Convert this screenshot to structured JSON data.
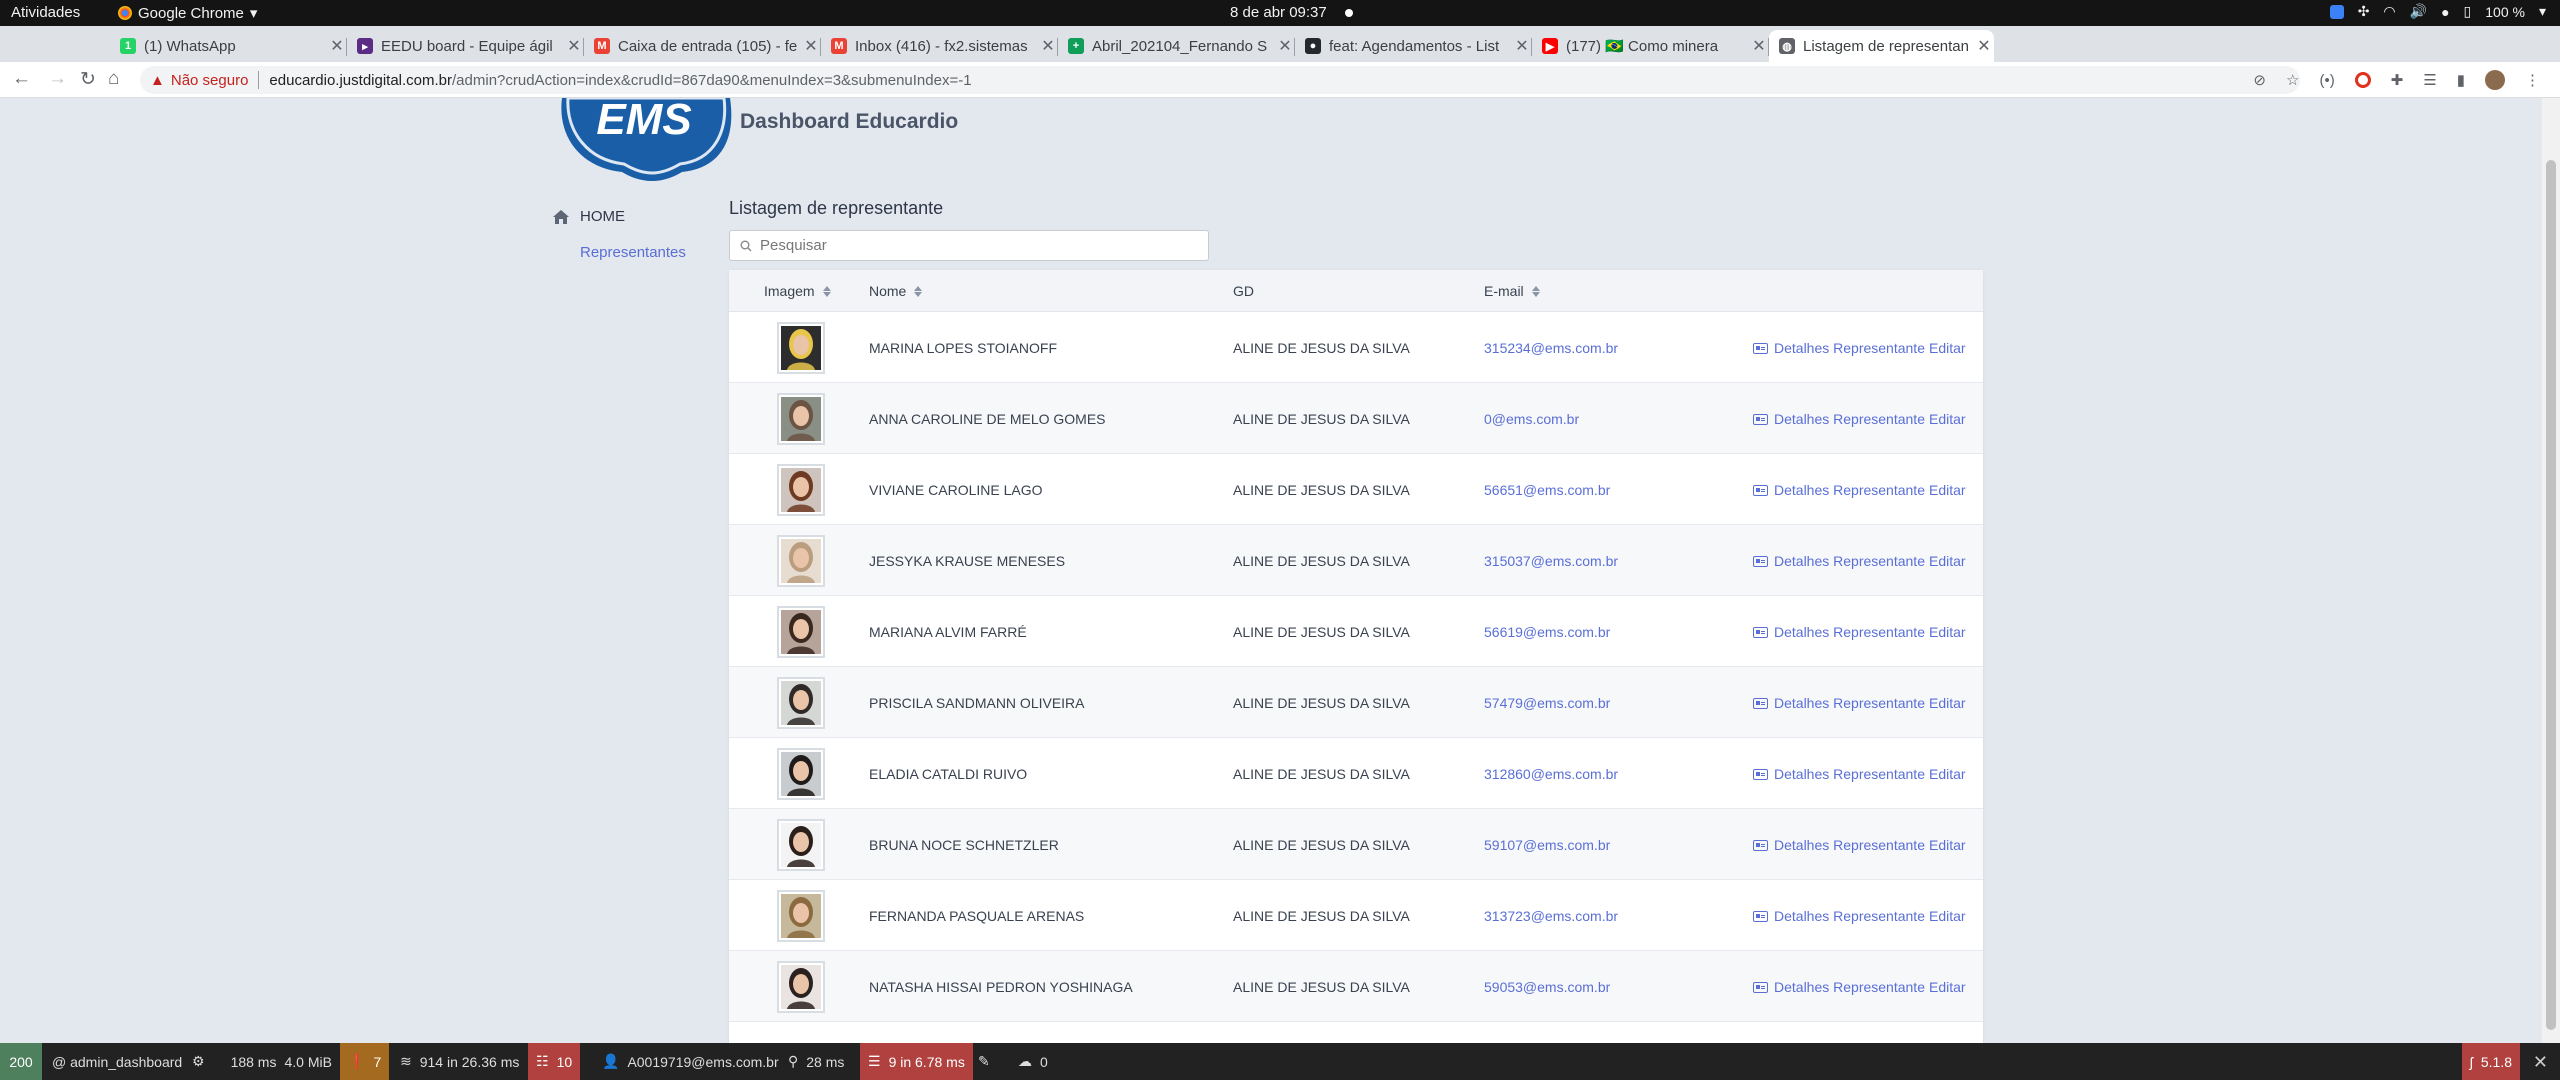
{
  "topbar": {
    "activities": "Atividades",
    "app_name": "Google Chrome",
    "clock": "8 de abr  09:37",
    "battery": "100 %"
  },
  "browser": {
    "tabs": [
      {
        "title": "(1) WhatsApp",
        "fav_color": "#25d366",
        "fav_glyph": "1"
      },
      {
        "title": "EEDU board - Equipe ágil",
        "fav_color": "#5b2c83",
        "fav_glyph": "▸"
      },
      {
        "title": "Caixa de entrada (105) - fe",
        "fav_color": "#ea4335",
        "fav_glyph": "M"
      },
      {
        "title": "Inbox (416) - fx2.sistemas",
        "fav_color": "#ea4335",
        "fav_glyph": "M"
      },
      {
        "title": "Abril_202104_Fernando S",
        "fav_color": "#0f9d58",
        "fav_glyph": "+"
      },
      {
        "title": "feat: Agendamentos - List",
        "fav_color": "#24292e",
        "fav_glyph": "●"
      },
      {
        "title": "(177) 🇧🇷 Como minera",
        "fav_color": "#ff0000",
        "fav_glyph": "▶"
      },
      {
        "title": "Listagem de representan",
        "fav_color": "#5f6368",
        "fav_glyph": "◍"
      }
    ],
    "url_insecure": "Não seguro",
    "url_host": "educardio.justdigital.com.br",
    "url_path": "/admin?crudAction=index&crudId=867da90&menuIndex=3&submenuIndex=-1"
  },
  "brand": {
    "logo_text": "EMS",
    "dashboard_title": "Dashboard Educardio"
  },
  "sidebar": {
    "home_label": "HOME",
    "items": [
      {
        "label": "Representantes"
      }
    ]
  },
  "main": {
    "title": "Listagem de representante",
    "search_placeholder": "Pesquisar",
    "columns": {
      "image": "Imagem",
      "name": "Nome",
      "gd": "GD",
      "email": "E-mail"
    },
    "action_details": "Detalhes Representante",
    "action_edit": "Editar",
    "rows": [
      {
        "name": "MARINA LOPES STOIANOFF",
        "gd": "ALINE DE JESUS DA SILVA",
        "email": "315234@ems.com.br",
        "hair": "#e8c64a",
        "bg": "#2d2d2d"
      },
      {
        "name": "ANNA CAROLINE DE MELO GOMES",
        "gd": "ALINE DE JESUS DA SILVA",
        "email": "0@ems.com.br",
        "hair": "#6b5444",
        "bg": "#8a8f86"
      },
      {
        "name": "VIVIANE CAROLINE LAGO",
        "gd": "ALINE DE JESUS DA SILVA",
        "email": "56651@ems.com.br",
        "hair": "#6e3a22",
        "bg": "#cfc4bd"
      },
      {
        "name": "JESSYKA KRAUSE MENESES",
        "gd": "ALINE DE JESUS DA SILVA",
        "email": "315037@ems.com.br",
        "hair": "#b99d7e",
        "bg": "#e6dccf"
      },
      {
        "name": "MARIANA ALVIM FARRÉ",
        "gd": "ALINE DE JESUS DA SILVA",
        "email": "56619@ems.com.br",
        "hair": "#3a2820",
        "bg": "#b6a49a"
      },
      {
        "name": "PRISCILA SANDMANN OLIVEIRA",
        "gd": "ALINE DE JESUS DA SILVA",
        "email": "57479@ems.com.br",
        "hair": "#2f2a28",
        "bg": "#d4d7d3"
      },
      {
        "name": "ELADIA CATALDI RUIVO",
        "gd": "ALINE DE JESUS DA SILVA",
        "email": "312860@ems.com.br",
        "hair": "#1f1b1a",
        "bg": "#c9cccf"
      },
      {
        "name": "BRUNA NOCE SCHNETZLER",
        "gd": "ALINE DE JESUS DA SILVA",
        "email": "59107@ems.com.br",
        "hair": "#2a1f1b",
        "bg": "#f3f3f3"
      },
      {
        "name": "FERNANDA PASQUALE ARENAS",
        "gd": "ALINE DE JESUS DA SILVA",
        "email": "313723@ems.com.br",
        "hair": "#8b6a3f",
        "bg": "#c6b89a"
      },
      {
        "name": "NATASHA HISSAI PEDRON YOSHINAGA",
        "gd": "ALINE DE JESUS DA SILVA",
        "email": "59053@ems.com.br",
        "hair": "#2b2220",
        "bg": "#e9e4e2"
      }
    ]
  },
  "symfony": {
    "status": "200",
    "route": "@ admin_dashboard",
    "time": "188 ms",
    "memory": "4.0 MiB",
    "warnings": "7",
    "templates": "914 in 26.36 ms",
    "logs": "10",
    "user": "A0019719@ems.com.br",
    "events": "28 ms",
    "db": "9 in 6.78 ms",
    "cache": "0",
    "version": "5.1.8"
  },
  "colors": {
    "accent": "#5a6fd6",
    "logo_blue": "#1a5ea8",
    "insecure": "#c5221f"
  }
}
